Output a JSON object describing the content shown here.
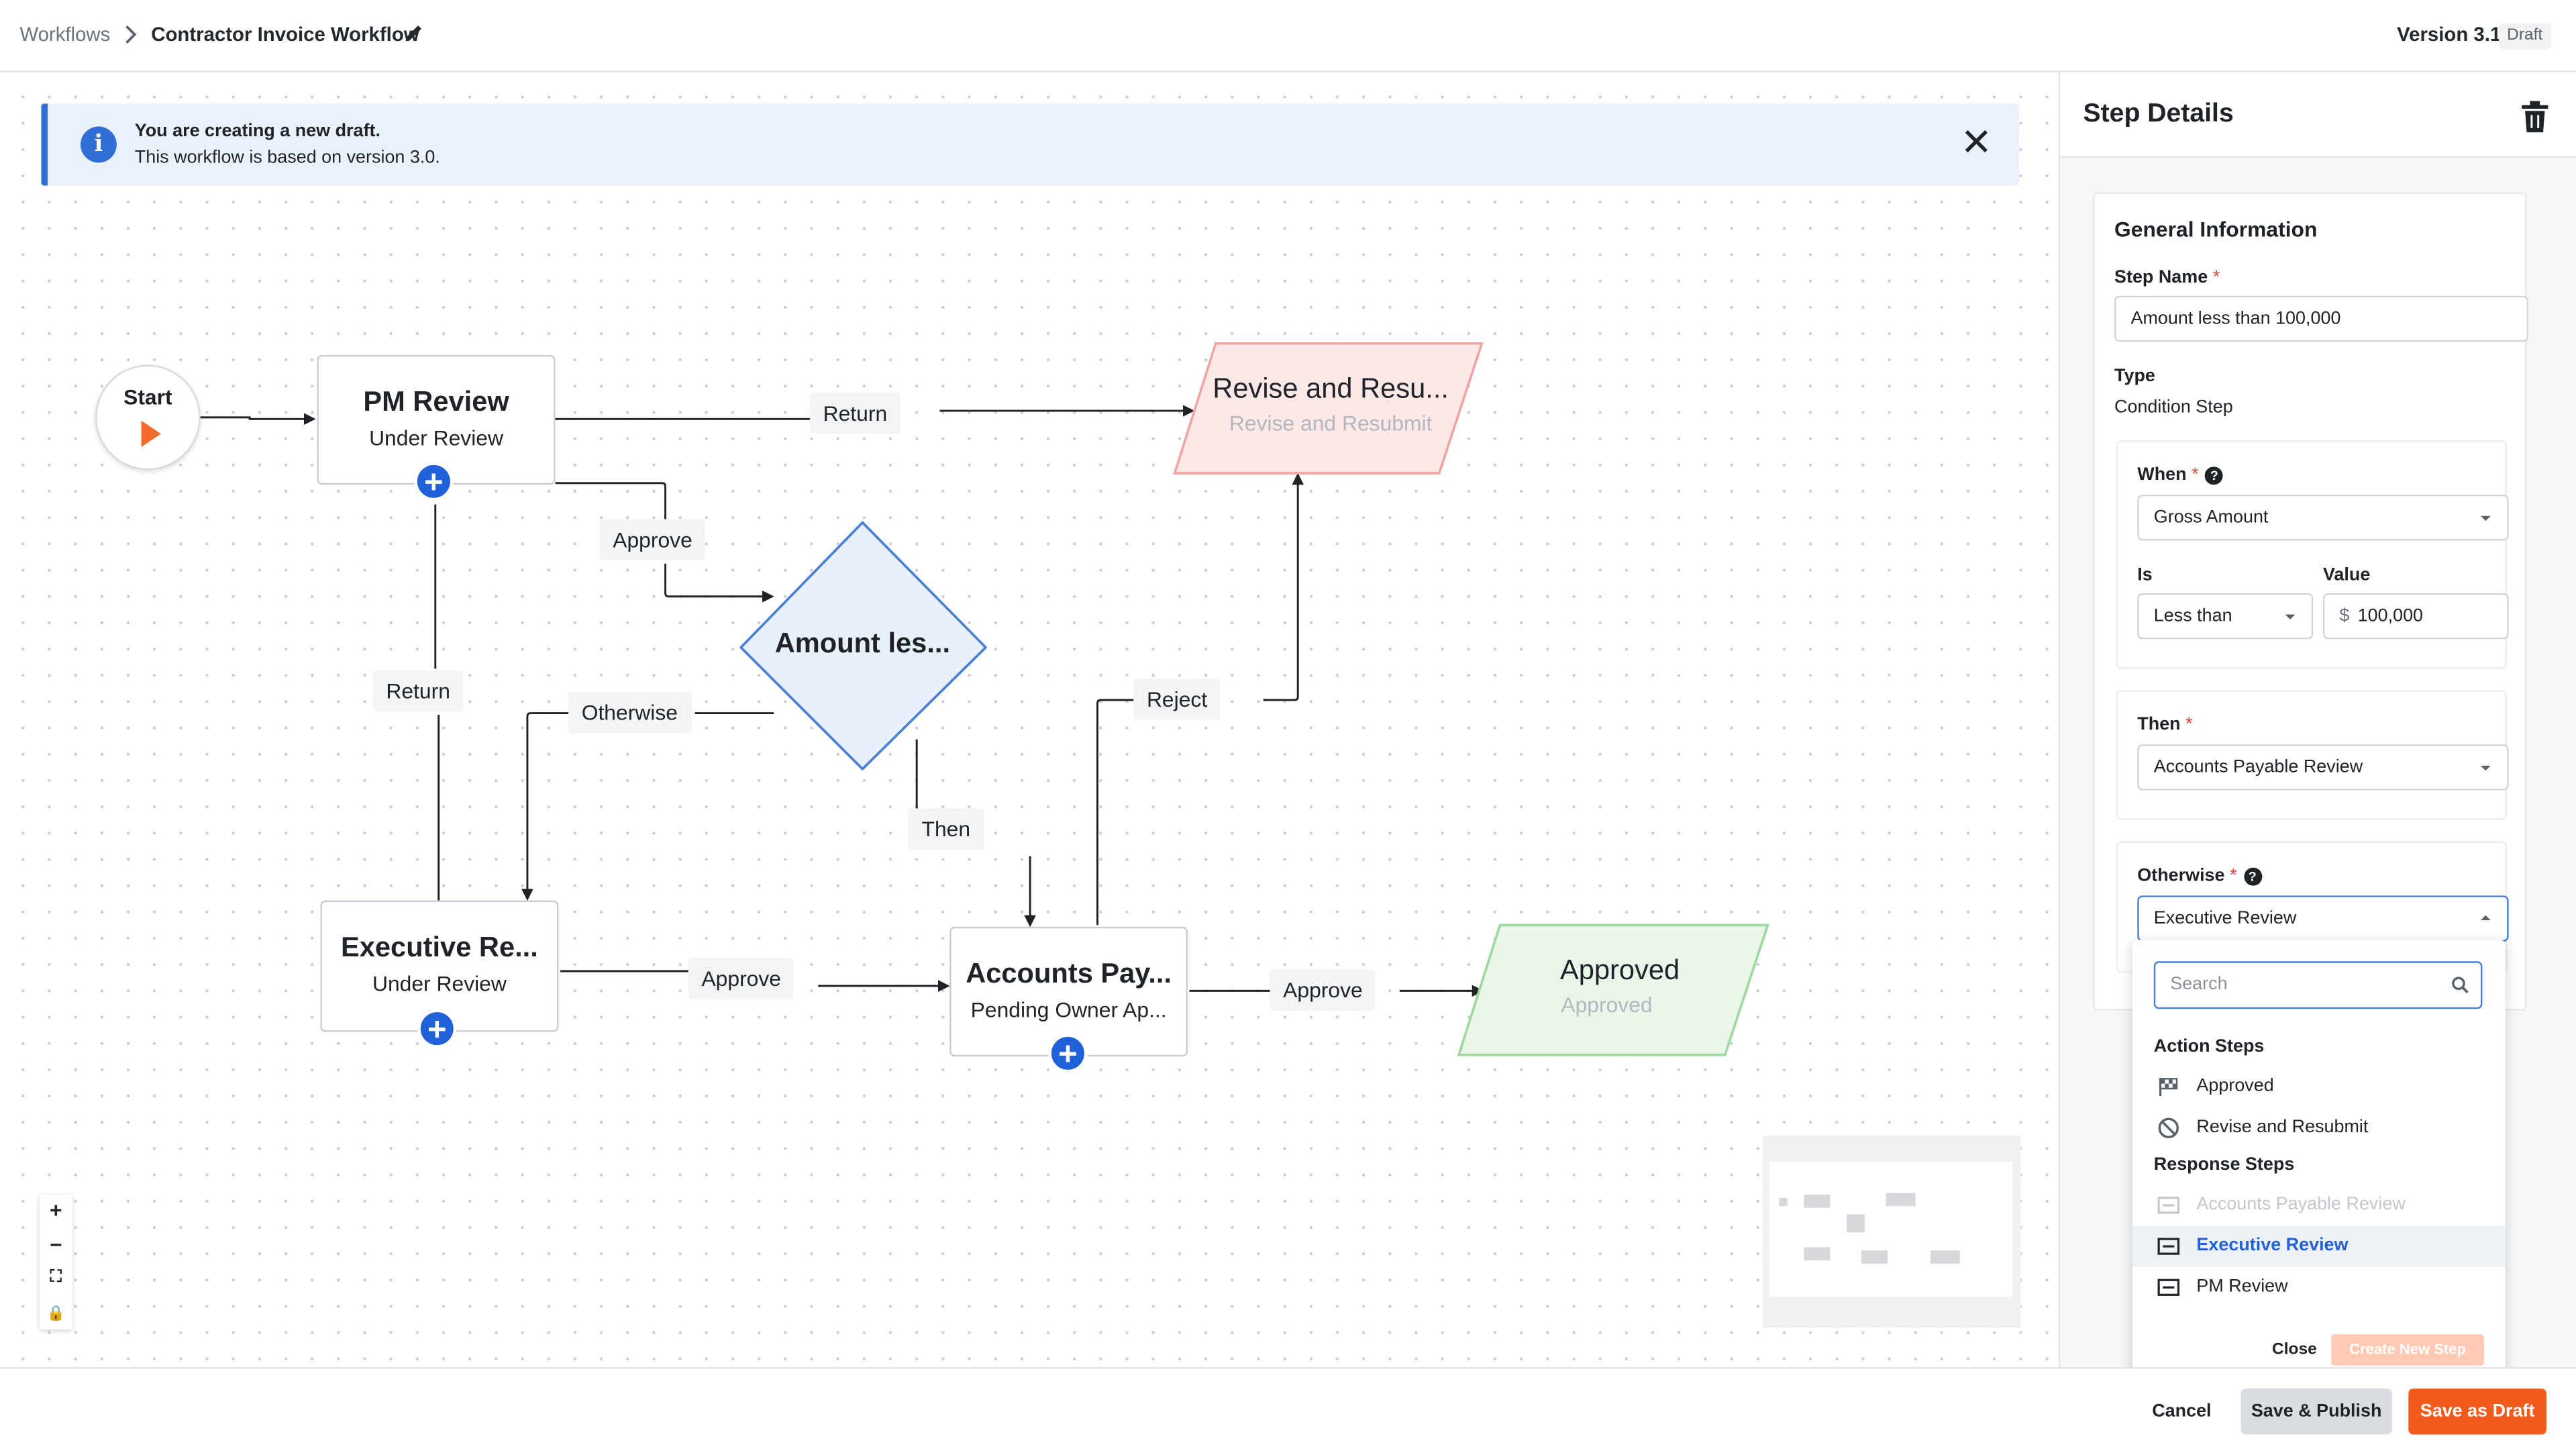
{
  "header": {
    "breadcrumb_root": "Workflows",
    "workflow_name": "Contractor Invoice Workflow",
    "version": "Version 3.1",
    "status_badge": "Draft"
  },
  "banner": {
    "title": "You are creating a new draft.",
    "subtitle": "This workflow is based on version 3.0.",
    "icon": "info-icon"
  },
  "canvas": {
    "start_label": "Start",
    "nodes": {
      "pm_review": {
        "title": "PM Review",
        "status": "Under Review"
      },
      "revise": {
        "title": "Revise and Resu...",
        "status": "Revise and Resubmit"
      },
      "condition": {
        "title": "Amount les..."
      },
      "executive": {
        "title": "Executive Re...",
        "status": "Under Review"
      },
      "accounts": {
        "title": "Accounts Pay...",
        "status": "Pending Owner Ap..."
      },
      "approved": {
        "title": "Approved",
        "status": "Approved"
      }
    },
    "edge_labels": {
      "return_top": "Return",
      "approve_pm": "Approve",
      "return_left": "Return",
      "otherwise": "Otherwise",
      "reject": "Reject",
      "then": "Then",
      "approve_exec": "Approve",
      "approve_ap": "Approve"
    },
    "zoom_controls": [
      "+",
      "−",
      "⛶",
      "🔒"
    ]
  },
  "panel": {
    "title": "Step Details",
    "section_title": "General Information",
    "step_name_label": "Step Name",
    "step_name_value": "Amount less than 100,000",
    "type_label": "Type",
    "type_value": "Condition Step",
    "when_label": "When",
    "when_value": "Gross Amount",
    "is_label": "Is",
    "is_value": "Less than",
    "value_label": "Value",
    "value_prefix": "$",
    "value_value": "100,000",
    "then_label": "Then",
    "then_value": "Accounts Payable Review",
    "otherwise_label": "Otherwise",
    "otherwise_value": "Executive Review",
    "required_mark": "*"
  },
  "dropdown": {
    "search_placeholder": "Search",
    "group_action": "Action Steps",
    "group_response": "Response Steps",
    "action_items": [
      {
        "label": "Approved",
        "icon": "flag-icon"
      },
      {
        "label": "Revise and Resubmit",
        "icon": "ban-icon"
      }
    ],
    "response_items": [
      {
        "label": "Accounts Payable Review",
        "icon": "card-icon",
        "state": "disabled"
      },
      {
        "label": "Executive Review",
        "icon": "card-icon",
        "state": "selected"
      },
      {
        "label": "PM Review",
        "icon": "card-icon",
        "state": "normal"
      }
    ],
    "close_label": "Close",
    "create_label": "Create New Step"
  },
  "footer": {
    "cancel": "Cancel",
    "save_publish": "Save & Publish",
    "save_draft": "Save as Draft"
  },
  "colors": {
    "primary_blue": "#2060d8",
    "accent_orange": "#f35b1c",
    "revise_fill": "#fde8e8",
    "approved_fill": "#e9f6e9",
    "condition_fill": "#e8f0fb"
  }
}
